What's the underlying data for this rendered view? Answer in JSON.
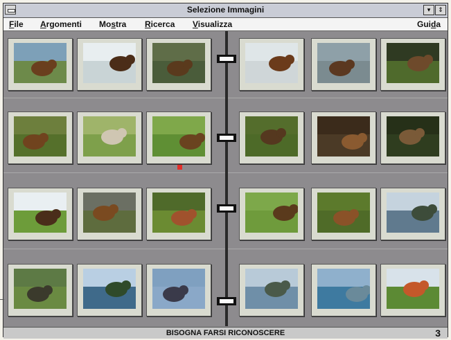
{
  "window": {
    "title": "Selezione Immagini",
    "minimize_glyph": "▾",
    "restore_glyph": "⇕"
  },
  "menu": {
    "items": [
      {
        "id": "file",
        "label": "File"
      },
      {
        "id": "argomenti",
        "label": "Argomenti"
      },
      {
        "id": "mostra",
        "label": "Mostra"
      },
      {
        "id": "ricerca",
        "label": "Ricerca"
      },
      {
        "id": "visualizza",
        "label": "Visualizza"
      },
      {
        "id": "guida",
        "label": "Guida"
      }
    ]
  },
  "gallery": {
    "rows": 4,
    "columns_per_side": 3,
    "sides": [
      "left",
      "right"
    ],
    "thumbnails": [
      {
        "subject": "bear by river bank",
        "sky": "#7da0b8",
        "ground": "#6d8a4a",
        "accent": "#6a3f1e"
      },
      {
        "subject": "bear in white water",
        "sky": "#e8eef0",
        "ground": "#c9d4d6",
        "accent": "#4b2d18"
      },
      {
        "subject": "bear fishing in river",
        "sky": "#5f6d48",
        "ground": "#4a5c3a",
        "accent": "#5a3a1d"
      },
      {
        "subject": "bear close-up",
        "sky": "#dfe6e8",
        "ground": "#cfd6d8",
        "accent": "#6b3b1b"
      },
      {
        "subject": "bear face portrait",
        "sky": "#8ea0a8",
        "ground": "#7b8b90",
        "accent": "#5b3820"
      },
      {
        "subject": "bear in dark cave of grass",
        "sky": "#2f3a22",
        "ground": "#4f6a2c",
        "accent": "#6e4a2b"
      },
      {
        "subject": "bear resting in grass",
        "sky": "#6d7f3d",
        "ground": "#55702b",
        "accent": "#70431e"
      },
      {
        "subject": "pale bear in meadow",
        "sky": "#9fb46a",
        "ground": "#7ea04b",
        "accent": "#cfc6b2"
      },
      {
        "subject": "bear cub in grass",
        "sky": "#7fa84a",
        "ground": "#5f8f34",
        "accent": "#6a431f"
      },
      {
        "subject": "bear lying on grass",
        "sky": "#546d2c",
        "ground": "#4d6a28",
        "accent": "#55381f"
      },
      {
        "subject": "bear in motion",
        "sky": "#3b2b1b",
        "ground": "#4b3a26",
        "accent": "#8a5a30"
      },
      {
        "subject": "bear among dark foliage",
        "sky": "#263018",
        "ground": "#2f3d1f",
        "accent": "#7a5a38"
      },
      {
        "subject": "bear on green lawn",
        "sky": "#e9eff2",
        "ground": "#6d9c3a",
        "accent": "#4a2e1a"
      },
      {
        "subject": "bear near rock wall",
        "sky": "#6b6f63",
        "ground": "#5e6c3e",
        "accent": "#7a4a20"
      },
      {
        "subject": "bear walking in field",
        "sky": "#4f6a2a",
        "ground": "#6b8b32",
        "accent": "#a0522d"
      },
      {
        "subject": "bear sitting in grass",
        "sky": "#7da84a",
        "ground": "#6f9b3c",
        "accent": "#5a3a1c"
      },
      {
        "subject": "bear head close-up",
        "sky": "#5c7a2c",
        "ground": "#4f6b28",
        "accent": "#8a5228"
      },
      {
        "subject": "lake with mountains",
        "sky": "#c5d3de",
        "ground": "#607a8e",
        "accent": "#3d4c3a"
      },
      {
        "subject": "river landscape",
        "sky": "#5d7a45",
        "ground": "#6a8a42",
        "accent": "#3b3a2c"
      },
      {
        "subject": "stream among trees",
        "sky": "#b9cfe3",
        "ground": "#3f6a8a",
        "accent": "#2f4a2a"
      },
      {
        "subject": "fisherman in river",
        "sky": "#7fa0c0",
        "ground": "#8aa8c8",
        "accent": "#3a3a4a"
      },
      {
        "subject": "calm lake",
        "sky": "#b8cad8",
        "ground": "#6f8fa8",
        "accent": "#4a5a4a"
      },
      {
        "subject": "mountain lake",
        "sky": "#8fb0cc",
        "ground": "#3e7aa0",
        "accent": "#6a8a9a"
      },
      {
        "subject": "green valley",
        "sky": "#d8e2ea",
        "ground": "#5c8a34",
        "accent": "#c4582a"
      }
    ]
  },
  "status": {
    "text": "BISOGNA FARSI RICONOSCERE",
    "page": "3"
  }
}
